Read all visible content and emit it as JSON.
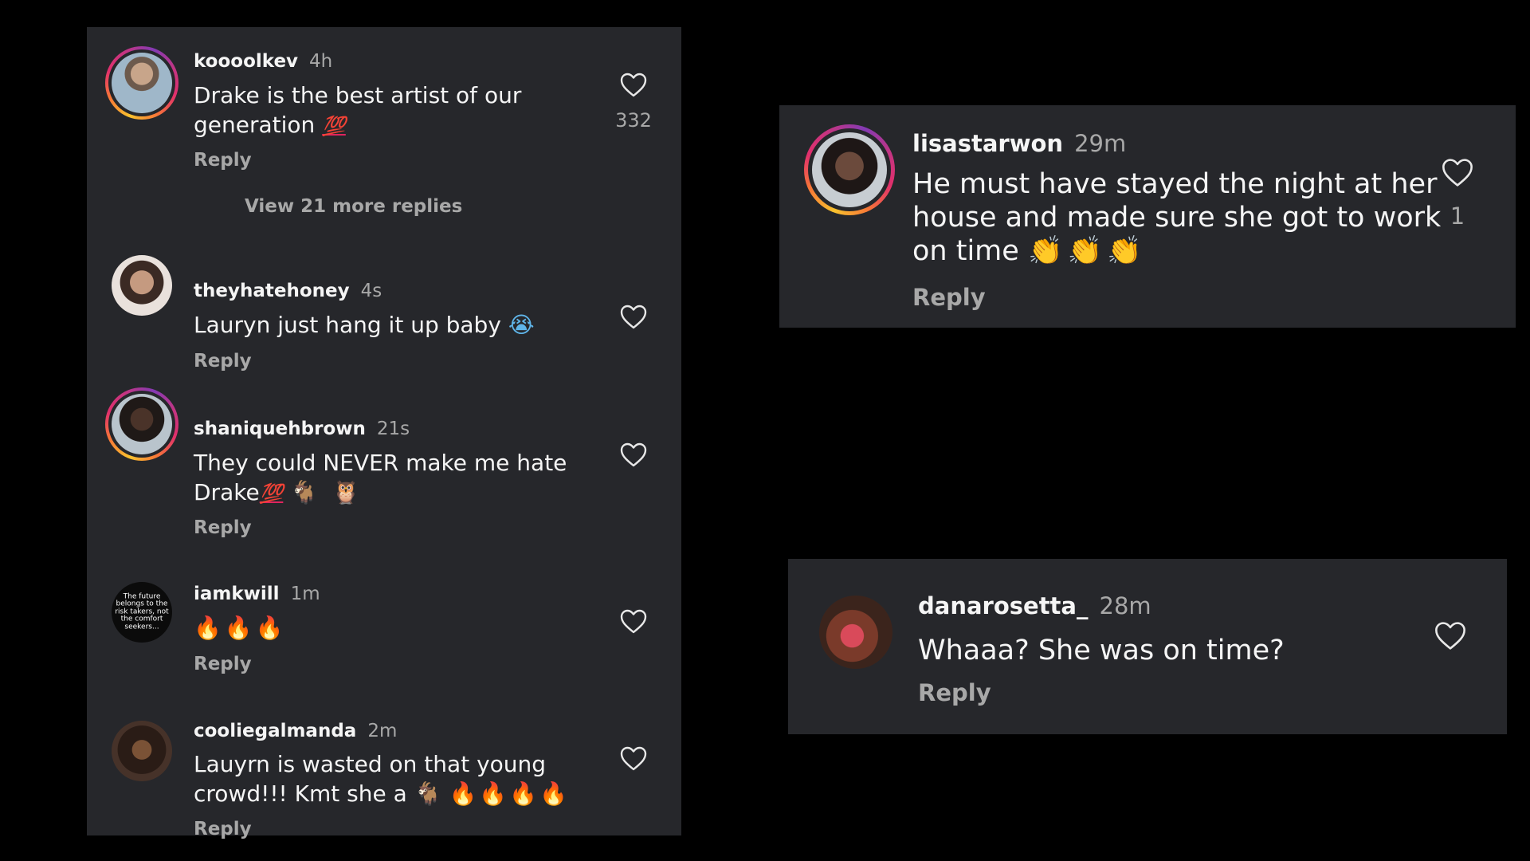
{
  "left_panel": {
    "comments": [
      {
        "username": "koooolkev",
        "time": "4h",
        "text_line1": "Drake is the best artist of our",
        "text_line2": "generation",
        "emoji_line2": "💯",
        "reply_label": "Reply",
        "likes": "332",
        "view_more": "View 21 more replies"
      },
      {
        "username": "theyhatehoney",
        "time": "4s",
        "text_line1": "Lauryn just hang it up baby",
        "emoji_line1": "😭",
        "reply_label": "Reply"
      },
      {
        "username": "shaniquehbrown",
        "time": "21s",
        "text_line1": "They could NEVER make me hate",
        "text_line2": "Drake",
        "emoji_line2": "💯",
        "emoji_goat": "🐐",
        "emoji_owl": "🦉",
        "reply_label": "Reply"
      },
      {
        "username": "iamkwill",
        "time": "1m",
        "emoji_line1": "🔥🔥🔥",
        "avatar_text": "The future belongs to the risk takers, not the comfort seekers...",
        "reply_label": "Reply"
      },
      {
        "username": "cooliegalmanda",
        "time": "2m",
        "text_line1": "Lauyrn is wasted on that young",
        "text_line2": "crowd!!! Kmt she a",
        "emoji_goat": "🐐",
        "emoji_fire": "🔥🔥🔥🔥",
        "reply_label": "Reply"
      }
    ]
  },
  "top_right": {
    "username": "lisastarwon",
    "time": "29m",
    "text_line1": "He must have stayed the night at her",
    "text_line2": "house and made sure she got to work",
    "text_line3": "on time",
    "emoji_line3": "👏👏👏",
    "reply_label": "Reply",
    "likes": "1"
  },
  "bottom_right": {
    "username": "danarosetta_",
    "time": "28m",
    "text_line1": "Whaaa? She was on time?",
    "reply_label": "Reply"
  },
  "icons": {
    "like": "heart-outline-icon"
  },
  "colors": {
    "background": "#000000",
    "panel": "#26272b",
    "text": "#f5f5f5",
    "muted": "#a8a8a8",
    "story_ring_start": "#f9c22e",
    "story_ring_end": "#c13584"
  }
}
